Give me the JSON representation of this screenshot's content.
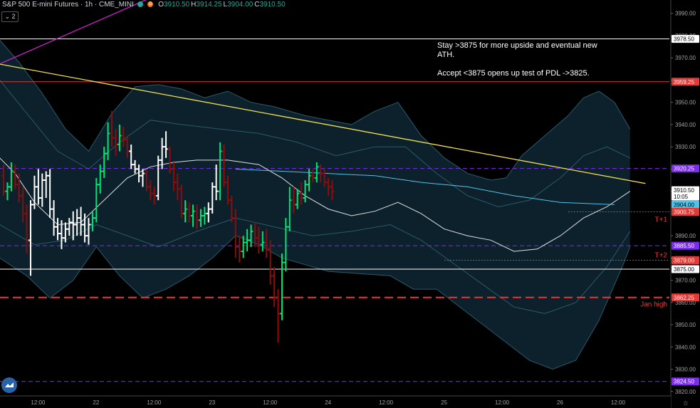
{
  "header": {
    "symbol": "S&P 500 E-mini Futures · 1h · CME_MINI",
    "badge_d": "D",
    "ohlc": [
      {
        "k": "O",
        "v": "3910.50"
      },
      {
        "k": "H",
        "v": "3914.25"
      },
      {
        "k": "L",
        "v": "3904.00"
      },
      {
        "k": "C",
        "v": "3910.50"
      }
    ],
    "collapse_label": "⌄ 2"
  },
  "note": {
    "line1": "Stay >3875 for more upside and eventual new ATH.",
    "line2": "Accept <3875 opens up test of PDL ->3825."
  },
  "colors": {
    "up": "#00e676",
    "down": "#8b0d0d",
    "neutral": "#ffffff",
    "band_fill": "#0d2530",
    "band_line": "#2a5a6a",
    "ma_fast": "#e0e0e0",
    "ma_cyan": "#4fc3e8",
    "trend_yellow": "#f0e050",
    "trend_magenta": "#d020d0",
    "level_red": "#e53935",
    "level_purple": "#7c2cf0",
    "level_white": "#ffffff"
  },
  "chart_data": {
    "type": "candlestick",
    "symbol": "S&P 500 E-mini Futures",
    "interval": "1h",
    "ylim": [
      3818,
      3996
    ],
    "y_ticks": [
      3820,
      3830,
      3840,
      3850,
      3860,
      3870,
      3880,
      3890,
      3910,
      3920,
      3930,
      3940,
      3950,
      3960,
      3970,
      3980,
      3990
    ],
    "x_ticks": [
      {
        "label": "12:00",
        "x": 8
      },
      {
        "label": "22",
        "x": 23
      },
      {
        "label": "12:00",
        "x": 38
      },
      {
        "label": "23",
        "x": 53
      },
      {
        "label": "12:00",
        "x": 68
      },
      {
        "label": "24",
        "x": 83
      },
      {
        "label": "12:00",
        "x": 98
      },
      {
        "label": "25",
        "x": 113
      },
      {
        "label": "12:00",
        "x": 128
      },
      {
        "label": "26",
        "x": 143
      },
      {
        "label": "12:00",
        "x": 158
      }
    ],
    "price_labels": [
      {
        "value": "3978.50",
        "price": 3978.5,
        "color": "#ffffff",
        "text": "#000000"
      },
      {
        "value": "3959.25",
        "price": 3959.25,
        "color": "#e53935",
        "text": "#ffffff"
      },
      {
        "value": "3920.25",
        "price": 3920.25,
        "color": "#7c2cf0",
        "text": "#ffffff"
      },
      {
        "value": "3910.50",
        "price": 3910.5,
        "color": "#ffffff",
        "text": "#000000"
      },
      {
        "value": "10:05",
        "price": 3907.6,
        "color": "#ffffff",
        "text": "#000000"
      },
      {
        "value": "3904.00",
        "price": 3904.0,
        "color": "#4fc3e8",
        "text": "#000000"
      },
      {
        "value": "3900.75",
        "price": 3900.75,
        "color": "#e53935",
        "text": "#ffffff"
      },
      {
        "value": "3885.50",
        "price": 3885.5,
        "color": "#7c2cf0",
        "text": "#ffffff"
      },
      {
        "value": "3879.00",
        "price": 3879.0,
        "color": "#e53935",
        "text": "#ffffff"
      },
      {
        "value": "3875.00",
        "price": 3875.0,
        "color": "#ffffff",
        "text": "#000000"
      },
      {
        "value": "3862.25",
        "price": 3862.25,
        "color": "#e53935",
        "text": "#ffffff"
      },
      {
        "value": "3824.50",
        "price": 3824.5,
        "color": "#7c2cf0",
        "text": "#ffffff"
      }
    ],
    "levels": [
      {
        "price": 3978.5,
        "style": "solid",
        "color": "#ffffff",
        "start": 0
      },
      {
        "price": 3959.25,
        "style": "solid",
        "color": "#e53935",
        "start": 0
      },
      {
        "price": 3920.25,
        "style": "dashed",
        "color": "#7c2cf0",
        "start": 0
      },
      {
        "price": 3885.5,
        "style": "dashed",
        "color": "#7c2cf0",
        "start": 0
      },
      {
        "price": 3875.0,
        "style": "solid",
        "color": "#ffffff",
        "start": 0
      },
      {
        "price": 3862.25,
        "style": "bigdash",
        "color": "#e53935",
        "start": 0
      },
      {
        "price": 3824.5,
        "style": "dashed",
        "color": "#7c2cf0",
        "start": 0
      },
      {
        "price": 3900.75,
        "style": "dotted",
        "color": "#e53935",
        "start": 146
      },
      {
        "price": 3879.0,
        "style": "dotted",
        "color": "#e53935",
        "start": 114
      }
    ],
    "annotations": [
      {
        "text": "T+1",
        "price": 3897.5,
        "color": "#e53935"
      },
      {
        "text": "T+2",
        "price": 3881.5,
        "color": "#e53935"
      },
      {
        "text": "Jan high",
        "price": 3859.5,
        "color": "#e53935"
      }
    ],
    "trendlines": [
      {
        "name": "yellow",
        "x1": -2,
        "y1": 3967.5,
        "x2": 166,
        "y2": 3913.5,
        "color": "#f0e050"
      },
      {
        "name": "magenta",
        "x1": -2,
        "y1": 3966.5,
        "x2": 40,
        "y2": 3998.5,
        "color": "#d020d0"
      }
    ],
    "bars": [
      [
        3917,
        3922,
        3908,
        3910
      ],
      [
        3910,
        3914,
        3906,
        3912
      ],
      [
        3912,
        3923,
        3910,
        3919
      ],
      [
        3919,
        3922,
        3911,
        3913
      ],
      [
        3913,
        3918,
        3905,
        3908
      ],
      [
        3908,
        3912,
        3896,
        3900
      ],
      [
        3900,
        3904,
        3882,
        3888
      ],
      [
        3888,
        3906,
        3872,
        3904
      ],
      [
        3904,
        3917,
        3902,
        3912
      ],
      [
        3912,
        3920,
        3904,
        3907
      ],
      [
        3907,
        3918,
        3903,
        3915
      ],
      [
        3915,
        3919,
        3907,
        3917
      ],
      [
        3917,
        3920,
        3898,
        3902
      ],
      [
        3902,
        3906,
        3890,
        3894
      ],
      [
        3894,
        3898,
        3888,
        3891
      ],
      [
        3891,
        3897,
        3884,
        3889
      ],
      [
        3889,
        3896,
        3887,
        3893
      ],
      [
        3893,
        3898,
        3890,
        3896
      ],
      [
        3896,
        3901,
        3888,
        3895
      ],
      [
        3895,
        3902,
        3890,
        3898
      ],
      [
        3898,
        3903,
        3890,
        3895
      ],
      [
        3895,
        3900,
        3887,
        3890
      ],
      [
        3890,
        3898,
        3886,
        3895
      ],
      [
        3895,
        3901,
        3892,
        3898
      ],
      [
        3898,
        3916,
        3896,
        3913
      ],
      [
        3913,
        3922,
        3909,
        3919
      ],
      [
        3919,
        3930,
        3916,
        3927
      ],
      [
        3927,
        3941,
        3924,
        3936
      ],
      [
        3936,
        3946,
        3930,
        3934
      ],
      [
        3934,
        3938,
        3926,
        3931
      ],
      [
        3931,
        3940,
        3928,
        3935
      ],
      [
        3935,
        3939,
        3930,
        3933
      ],
      [
        3933,
        3935,
        3925,
        3928
      ],
      [
        3928,
        3931,
        3920,
        3922
      ],
      [
        3922,
        3924,
        3918,
        3920
      ],
      [
        3920,
        3922,
        3914,
        3917
      ],
      [
        3917,
        3920,
        3912,
        3918
      ],
      [
        3918,
        3920,
        3910,
        3912
      ],
      [
        3912,
        3915,
        3906,
        3909
      ],
      [
        3909,
        3912,
        3904,
        3908
      ],
      [
        3908,
        3926,
        3906,
        3924
      ],
      [
        3924,
        3934,
        3920,
        3930
      ],
      [
        3930,
        3937,
        3925,
        3929
      ],
      [
        3929,
        3930,
        3918,
        3920
      ],
      [
        3920,
        3923,
        3910,
        3914
      ],
      [
        3914,
        3918,
        3906,
        3911
      ],
      [
        3911,
        3913,
        3898,
        3900
      ],
      [
        3900,
        3906,
        3896,
        3902
      ],
      [
        3902,
        3905,
        3896,
        3899
      ],
      [
        3899,
        3904,
        3894,
        3901
      ],
      [
        3901,
        3904,
        3893,
        3897
      ],
      [
        3897,
        3902,
        3894,
        3899
      ],
      [
        3899,
        3903,
        3895,
        3900
      ],
      [
        3900,
        3905,
        3896,
        3902
      ],
      [
        3902,
        3914,
        3900,
        3912
      ],
      [
        3912,
        3922,
        3906,
        3910
      ],
      [
        3910,
        3932,
        3906,
        3928
      ],
      [
        3928,
        3931,
        3912,
        3914
      ],
      [
        3914,
        3917,
        3904,
        3906
      ],
      [
        3906,
        3908,
        3896,
        3898
      ],
      [
        3898,
        3902,
        3880,
        3885
      ],
      [
        3885,
        3890,
        3878,
        3883
      ],
      [
        3883,
        3890,
        3880,
        3887
      ],
      [
        3887,
        3893,
        3883,
        3888
      ],
      [
        3888,
        3895,
        3885,
        3892
      ],
      [
        3892,
        3896,
        3885,
        3889
      ],
      [
        3889,
        3894,
        3882,
        3886
      ],
      [
        3886,
        3892,
        3883,
        3887
      ],
      [
        3887,
        3893,
        3880,
        3884
      ],
      [
        3884,
        3888,
        3868,
        3872
      ],
      [
        3872,
        3876,
        3858,
        3862
      ],
      [
        3862,
        3866,
        3842,
        3855
      ],
      [
        3855,
        3882,
        3852,
        3878
      ],
      [
        3878,
        3898,
        3874,
        3894
      ],
      [
        3894,
        3912,
        3892,
        3906
      ],
      [
        3906,
        3912,
        3900,
        3904
      ],
      [
        3904,
        3911,
        3902,
        3909
      ],
      [
        3909,
        3914,
        3904,
        3907
      ],
      [
        3907,
        3915,
        3905,
        3913
      ],
      [
        3913,
        3920,
        3910,
        3917
      ],
      [
        3917,
        3920,
        3914,
        3916
      ],
      [
        3916,
        3923,
        3914,
        3921
      ],
      [
        3921,
        3922,
        3914,
        3918
      ],
      [
        3918,
        3920,
        3912,
        3914
      ],
      [
        3914,
        3916,
        3908,
        3912
      ],
      [
        3912,
        3915,
        3906,
        3910
      ]
    ],
    "ma_fast": [
      [
        -1,
        3925
      ],
      [
        3,
        3918
      ],
      [
        8,
        3905
      ],
      [
        14,
        3895
      ],
      [
        20,
        3896
      ],
      [
        26,
        3906
      ],
      [
        32,
        3916
      ],
      [
        38,
        3921
      ],
      [
        44,
        3923
      ],
      [
        50,
        3924
      ],
      [
        58,
        3924
      ],
      [
        66,
        3922
      ],
      [
        72,
        3916
      ],
      [
        78,
        3908
      ],
      [
        84,
        3902
      ],
      [
        90,
        3899
      ],
      [
        96,
        3901
      ],
      [
        102,
        3905
      ],
      [
        108,
        3900
      ],
      [
        114,
        3893
      ],
      [
        120,
        3890
      ],
      [
        126,
        3888
      ],
      [
        132,
        3883
      ],
      [
        138,
        3884
      ],
      [
        144,
        3890
      ],
      [
        150,
        3898
      ],
      [
        156,
        3903
      ],
      [
        162,
        3910
      ]
    ],
    "ma_cyan": [
      [
        60,
        3920
      ],
      [
        72,
        3919
      ],
      [
        84,
        3918
      ],
      [
        96,
        3917
      ],
      [
        108,
        3914
      ],
      [
        120,
        3912
      ],
      [
        132,
        3908
      ],
      [
        144,
        3905
      ],
      [
        158,
        3904
      ]
    ],
    "band_upper": [
      [
        -1,
        3978
      ],
      [
        4,
        3968
      ],
      [
        10,
        3954
      ],
      [
        16,
        3938
      ],
      [
        22,
        3928
      ],
      [
        28,
        3945
      ],
      [
        34,
        3957
      ],
      [
        40,
        3958
      ],
      [
        46,
        3956
      ],
      [
        52,
        3952
      ],
      [
        58,
        3955
      ],
      [
        64,
        3950
      ],
      [
        70,
        3948
      ],
      [
        78,
        3944
      ],
      [
        84,
        3942
      ],
      [
        90,
        3940
      ],
      [
        96,
        3946
      ],
      [
        102,
        3950
      ],
      [
        108,
        3935
      ],
      [
        114,
        3925
      ],
      [
        120,
        3918
      ],
      [
        126,
        3915
      ],
      [
        130,
        3916
      ],
      [
        134,
        3926
      ],
      [
        140,
        3935
      ],
      [
        146,
        3944
      ],
      [
        150,
        3952
      ],
      [
        154,
        3955
      ],
      [
        158,
        3950
      ],
      [
        162,
        3938
      ]
    ],
    "band_mid_up": [
      [
        -1,
        3960
      ],
      [
        6,
        3945
      ],
      [
        14,
        3928
      ],
      [
        22,
        3920
      ],
      [
        30,
        3932
      ],
      [
        38,
        3942
      ],
      [
        46,
        3940
      ],
      [
        56,
        3938
      ],
      [
        66,
        3936
      ],
      [
        76,
        3932
      ],
      [
        86,
        3926
      ],
      [
        96,
        3930
      ],
      [
        104,
        3930
      ],
      [
        112,
        3918
      ],
      [
        120,
        3908
      ],
      [
        128,
        3903
      ],
      [
        136,
        3906
      ],
      [
        144,
        3916
      ],
      [
        150,
        3926
      ],
      [
        156,
        3930
      ],
      [
        162,
        3925
      ]
    ],
    "band_lower": [
      [
        -1,
        3880
      ],
      [
        6,
        3872
      ],
      [
        12,
        3862
      ],
      [
        18,
        3870
      ],
      [
        24,
        3885
      ],
      [
        30,
        3872
      ],
      [
        36,
        3862
      ],
      [
        42,
        3866
      ],
      [
        48,
        3872
      ],
      [
        54,
        3880
      ],
      [
        60,
        3890
      ],
      [
        66,
        3886
      ],
      [
        72,
        3880
      ],
      [
        78,
        3877
      ],
      [
        84,
        3874
      ],
      [
        92,
        3873
      ],
      [
        100,
        3872
      ],
      [
        106,
        3866
      ],
      [
        112,
        3866
      ],
      [
        118,
        3858
      ],
      [
        124,
        3850
      ],
      [
        130,
        3842
      ],
      [
        136,
        3834
      ],
      [
        142,
        3830
      ],
      [
        148,
        3834
      ],
      [
        154,
        3852
      ],
      [
        160,
        3876
      ],
      [
        162,
        3885
      ]
    ],
    "band_mid_low": [
      [
        -1,
        3895
      ],
      [
        8,
        3886
      ],
      [
        16,
        3888
      ],
      [
        24,
        3895
      ],
      [
        32,
        3890
      ],
      [
        40,
        3885
      ],
      [
        50,
        3892
      ],
      [
        60,
        3898
      ],
      [
        70,
        3894
      ],
      [
        80,
        3890
      ],
      [
        90,
        3892
      ],
      [
        100,
        3895
      ],
      [
        108,
        3888
      ],
      [
        116,
        3878
      ],
      [
        124,
        3868
      ],
      [
        132,
        3858
      ],
      [
        140,
        3855
      ],
      [
        148,
        3860
      ],
      [
        156,
        3876
      ],
      [
        162,
        3892
      ]
    ]
  }
}
